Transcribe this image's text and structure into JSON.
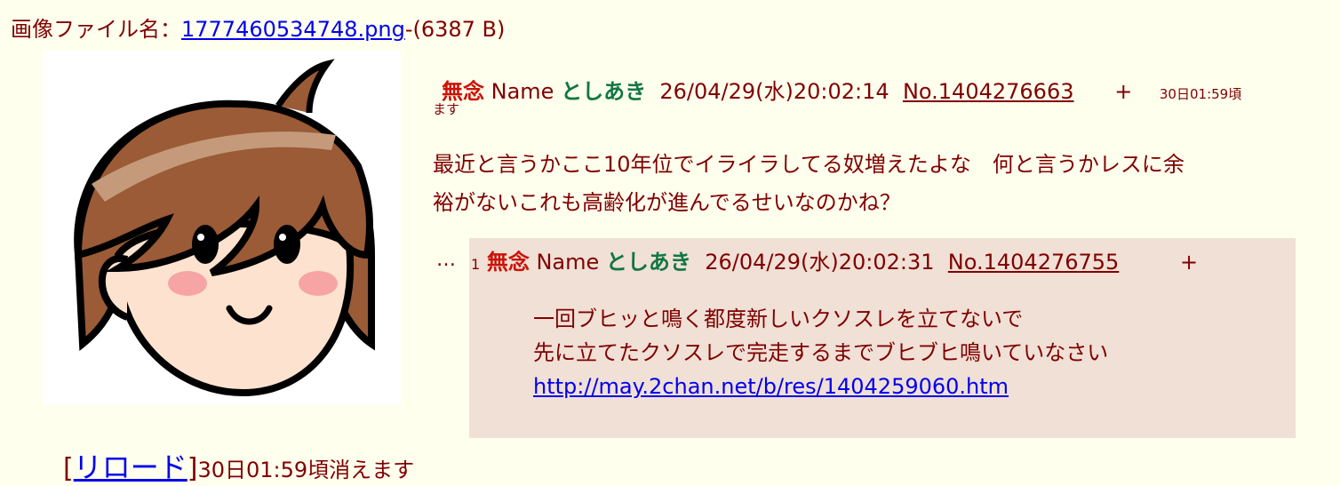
{
  "file": {
    "label": "画像ファイル名：",
    "filename": "1777460534748.png",
    "size": "-(6387 B)"
  },
  "op": {
    "subject": "無念",
    "name_label": "Name",
    "name": "としあき",
    "datetime": "26/04/29(水)20:02:14",
    "number": "No.1404276663",
    "del_label": "+",
    "expire_prefix": "30日01:59頃",
    "expire_suffix": "ます",
    "body_line1": "最近と言うかここ10年位でイライラしてる奴増えたよな　何と言うかレスに余",
    "body_line2": "裕がないこれも高齢化が進んでるせいなのかね？"
  },
  "reply": {
    "ellipsis": "…",
    "index": "1",
    "subject": "無念",
    "name_label": "Name",
    "name": "としあき",
    "datetime": "26/04/29(水)20:02:31",
    "number": "No.1404276755",
    "del_label": "+",
    "body_line1": "一回ブヒッと鳴く都度新しいクソスレを立てないで",
    "body_line2": "先に立てたクソスレで完走するまでブヒブヒ鳴いていなさい",
    "link": "http://may.2chan.net/b/res/1404259060.htm"
  },
  "footer": {
    "open_bracket": "[",
    "reload_label": "リロード",
    "close_bracket": "]",
    "expire_text": "30日01:59頃消えます"
  },
  "colors": {
    "background": "#ffffee",
    "reply_bg": "#f0e0d6",
    "text": "#800000",
    "subject": "#cc1105",
    "name": "#117743",
    "link": "#0000ee"
  },
  "thumbnail": {
    "icon": "anime-girl-face-icon"
  }
}
